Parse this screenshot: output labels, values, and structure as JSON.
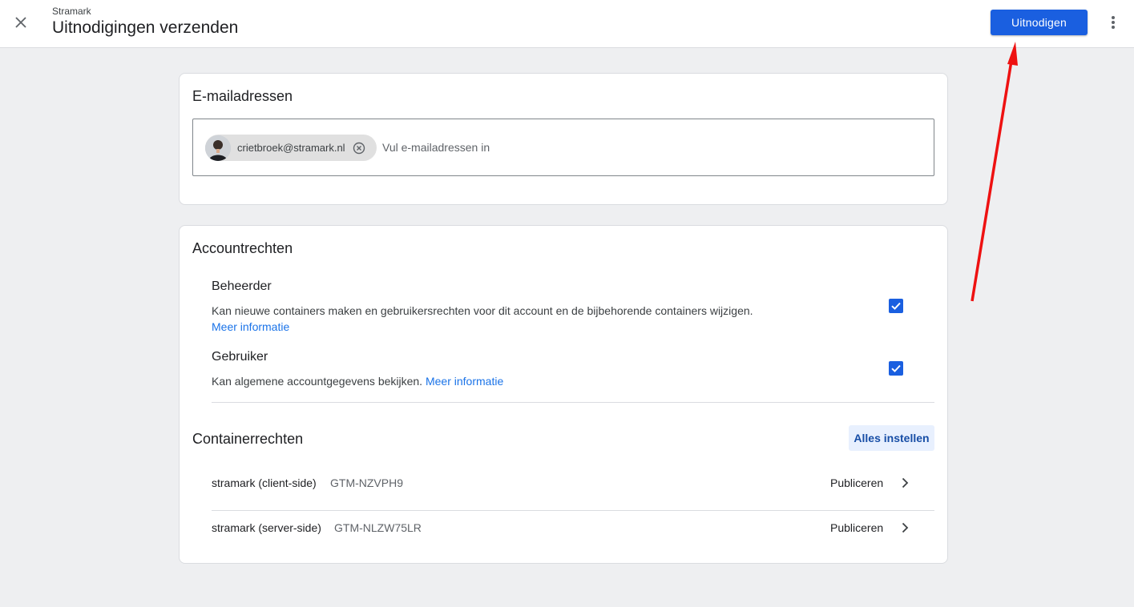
{
  "header": {
    "account_name": "Stramark",
    "title": "Uitnodigingen verzenden",
    "invite_label": "Uitnodigen"
  },
  "email_section": {
    "title": "E-mailadressen",
    "chip_email": "crietbroek@stramark.nl",
    "input_placeholder": "Vul e-mailadressen in"
  },
  "account_rights": {
    "title": "Accountrechten",
    "items": [
      {
        "title": "Beheerder",
        "description": "Kan nieuwe containers maken en gebruikersrechten voor dit account en de bijbehorende containers wijzigen.",
        "link": "Meer informatie",
        "checked": true
      },
      {
        "title": "Gebruiker",
        "description": "Kan algemene accountgegevens bekijken.",
        "link": "Meer informatie",
        "checked": true
      }
    ]
  },
  "container_rights": {
    "title": "Containerrechten",
    "set_all_label": "Alles instellen",
    "rows": [
      {
        "name": "stramark (client-side)",
        "id": "GTM-NZVPH9",
        "role": "Publiceren"
      },
      {
        "name": "stramark (server-side)",
        "id": "GTM-NLZW75LR",
        "role": "Publiceren"
      }
    ]
  },
  "colors": {
    "primary": "#1a5fe0",
    "link": "#1a73e8",
    "annotation_arrow": "#ee1111"
  },
  "icons": [
    "close-icon",
    "more-vert-icon",
    "cancel-circle-icon",
    "checkmark-icon",
    "chevron-right-icon"
  ]
}
